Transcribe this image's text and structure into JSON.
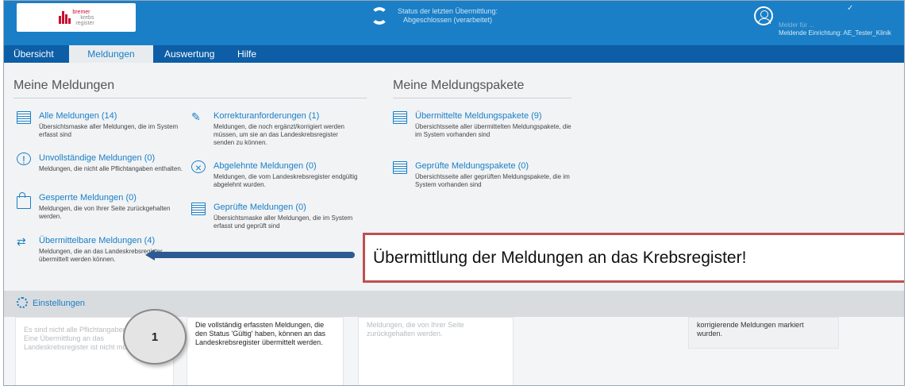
{
  "header": {
    "logo_text": [
      "bremer",
      "krebs",
      "register"
    ],
    "status_line1": "Status der letzten Übermittlung:",
    "status_line2": "Abgeschlossen (verarbeitet)",
    "user_name": "Melder für ...",
    "facility": "Meldende Einrichtung: AE_Tester_Klinik",
    "check": "✓"
  },
  "nav": {
    "items": [
      "Übersicht",
      "Meldungen",
      "Auswertung",
      "Hilfe"
    ],
    "active": "Meldungen"
  },
  "panel": {
    "left_heading": "Meine Meldungen",
    "right_heading": "Meine Meldungspakete",
    "col1": [
      {
        "icon": "document-stack-icon",
        "title": "Alle Meldungen (14)",
        "desc": "Übersichtsmaske aller Meldungen, die im System erfasst sind"
      },
      {
        "icon": "info-circle-icon",
        "title": "Unvollständige Meldungen (0)",
        "desc": "Meldungen, die nicht alle Pflichtangaben enthalten."
      },
      {
        "icon": "lock-icon",
        "title": "Gesperrte Meldungen (0)",
        "desc": "Meldungen, die von Ihrer Seite zurückgehalten werden."
      },
      {
        "icon": "transfer-arrows-icon",
        "title": "Übermittelbare Meldungen (4)",
        "desc": "Meldungen, die an das Landeskrebsregister übermittelt werden können."
      }
    ],
    "col2": [
      {
        "icon": "pencil-icon",
        "title": "Korrekturanforderungen (1)",
        "desc": "Meldungen, die noch ergänzt/korrigiert werden müssen, um sie an das Landeskrebsregister senden zu können."
      },
      {
        "icon": "x-circle-icon",
        "title": "Abgelehnte Meldungen (0)",
        "desc": "Meldungen, die vom Landeskrebsregister endgültig abgelehnt wurden."
      },
      {
        "icon": "checked-documents-icon",
        "title": "Geprüfte Meldungen (0)",
        "desc": "Übersichtsmaske aller Meldungen, die im System erfasst und geprüft sind"
      }
    ],
    "col3": [
      {
        "icon": "package-sent-icon",
        "title": "Übermittelte Meldungspakete (9)",
        "desc": "Übersichtsseite aller übermittelten Meldungspakete, die im System vorhanden sind"
      },
      {
        "icon": "package-checked-icon",
        "title": "Geprüfte Meldungspakete (0)",
        "desc": "Übersichtsseite aller geprüften Meldungspakete, die im System vorhanden sind"
      }
    ]
  },
  "callout": "Übermittlung der Meldungen an das Krebsregister!",
  "settings_label": "Einstellungen",
  "step_number": "1",
  "cards": {
    "c1": "Es sind nicht alle Pflichtangaben enthalten. Eine Übermittlung an das Landeskrebsregister ist nicht möglich.",
    "c2": "Die vollständig erfassten Meldungen, die den Status 'Gültig' haben, können an das Landeskrebsregister übermittelt werden.",
    "c3": "Meldungen, die von Ihrer Seite zurückgehalten werden.",
    "c4": "korrigierende Meldungen markiert wurden."
  }
}
